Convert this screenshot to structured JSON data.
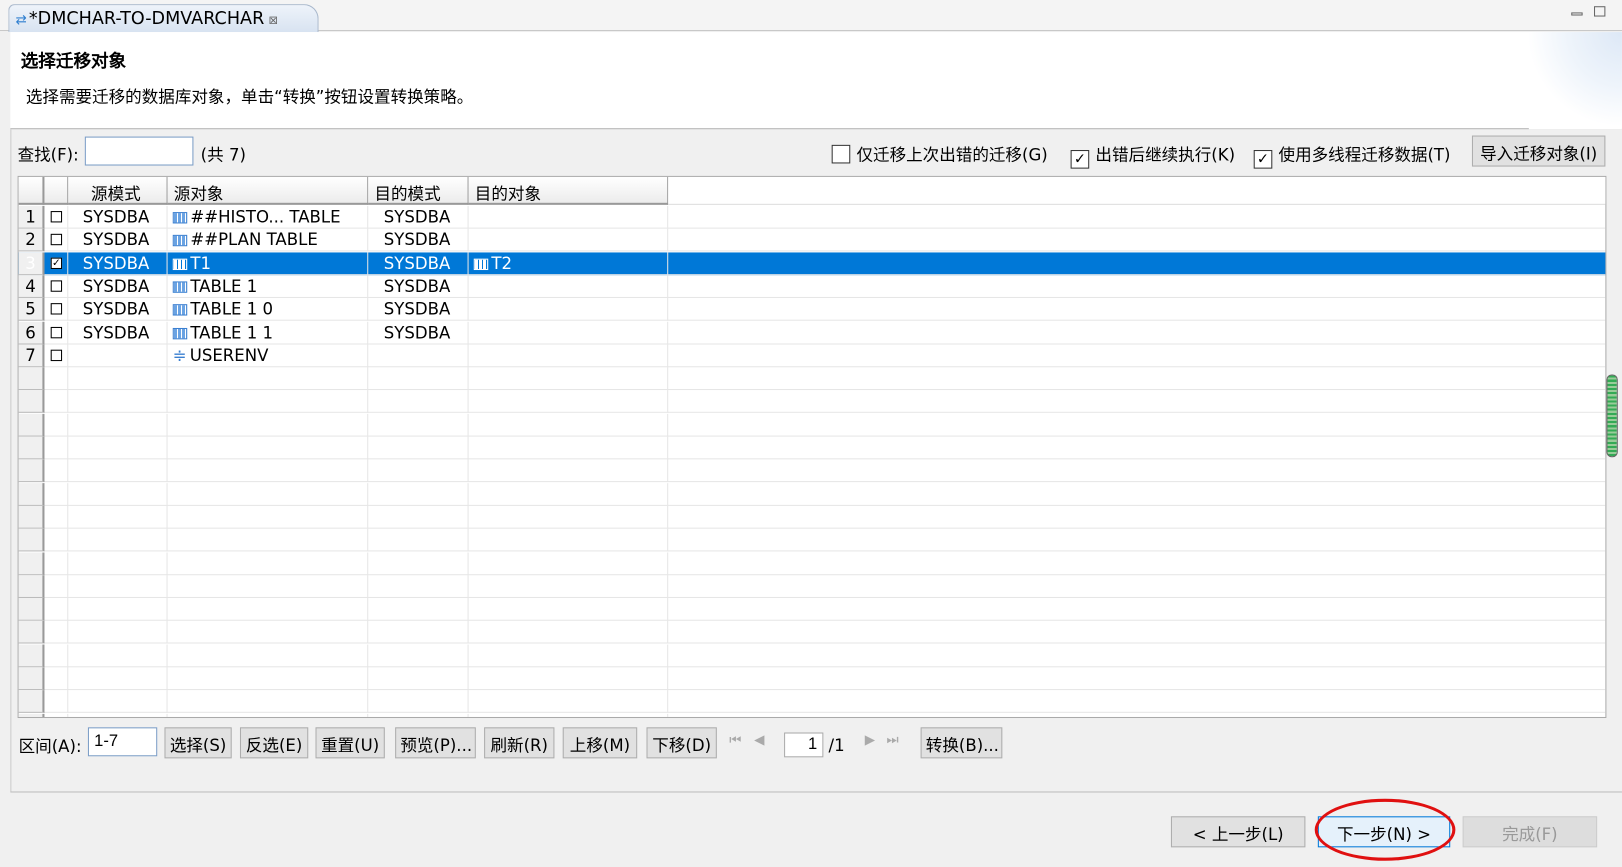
{
  "tab": {
    "title": "*DMCHAR-TO-DMVARCHAR",
    "icon": "migrate-arrows-icon"
  },
  "header": {
    "title": "选择迁移对象",
    "description": "选择需要迁移的数据库对象，单击“转换”按钮设置转换策略。"
  },
  "search": {
    "label": "查找(F):",
    "value": "",
    "count": "(共 7)"
  },
  "options": [
    {
      "label": "仅迁移上次出错的迁移(G)",
      "checked": false
    },
    {
      "label": "出错后继续执行(K)",
      "checked": true
    },
    {
      "label": "使用多线程迁移数据(T)",
      "checked": true
    }
  ],
  "import_button": "导入迁移对象(I)",
  "table": {
    "columns": [
      "源模式",
      "源对象",
      "目的模式",
      "目的对象"
    ],
    "rows": [
      {
        "n": "1",
        "checked": false,
        "src_schema": "SYSDBA",
        "src_obj": "##HISTO... TABLE",
        "icon": "table",
        "dst_schema": "SYSDBA",
        "dst_obj": ""
      },
      {
        "n": "2",
        "checked": false,
        "src_schema": "SYSDBA",
        "src_obj": "##PLAN TABLE",
        "icon": "table",
        "dst_schema": "SYSDBA",
        "dst_obj": ""
      },
      {
        "n": "3",
        "checked": true,
        "selected": true,
        "src_schema": "SYSDBA",
        "src_obj": "T1",
        "icon": "table",
        "dst_schema": "SYSDBA",
        "dst_obj": "T2"
      },
      {
        "n": "4",
        "checked": false,
        "src_schema": "SYSDBA",
        "src_obj": "TABLE 1",
        "icon": "table",
        "dst_schema": "SYSDBA",
        "dst_obj": ""
      },
      {
        "n": "5",
        "checked": false,
        "src_schema": "SYSDBA",
        "src_obj": "TABLE 1 0",
        "icon": "table",
        "dst_schema": "SYSDBA",
        "dst_obj": ""
      },
      {
        "n": "6",
        "checked": false,
        "src_schema": "SYSDBA",
        "src_obj": "TABLE 1 1",
        "icon": "table",
        "dst_schema": "SYSDBA",
        "dst_obj": ""
      },
      {
        "n": "7",
        "checked": false,
        "src_schema": "",
        "src_obj": "USERENV",
        "icon": "context",
        "dst_schema": "",
        "dst_obj": ""
      }
    ]
  },
  "range": {
    "label": "区间(A):",
    "value": "1-7"
  },
  "actions": [
    "选择(S)",
    "反选(E)",
    "重置(U)",
    "预览(P)...",
    "刷新(R)",
    "上移(M)",
    "下移(D)"
  ],
  "pager": {
    "page": "1",
    "total": "/1"
  },
  "convert_button": "转换(B)...",
  "footer": {
    "back": "< 上一步(L)",
    "next": "下一步(N) >",
    "finish": "完成(F)"
  }
}
